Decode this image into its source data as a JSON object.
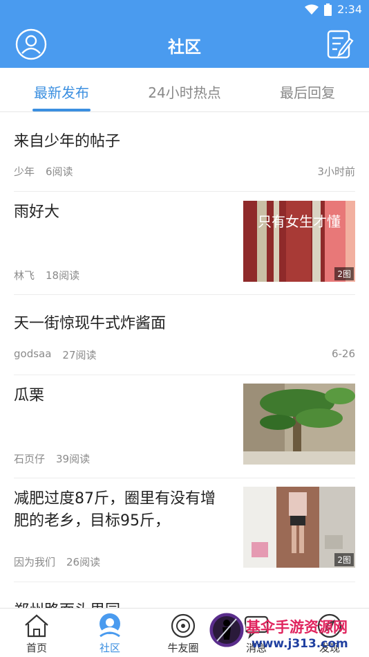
{
  "status_bar": {
    "time": "2:34"
  },
  "header": {
    "title": "社区"
  },
  "tabs": [
    {
      "label": "最新发布",
      "active": true
    },
    {
      "label": "24小时热点",
      "active": false
    },
    {
      "label": "最后回复",
      "active": false
    }
  ],
  "posts": [
    {
      "title": "来自少年的帖子",
      "author": "少年",
      "reads": "6阅读",
      "time": "3小时前"
    },
    {
      "title": "雨好大",
      "author": "林飞",
      "reads": "18阅读",
      "thumb_text": "只有女生才懂",
      "badge": "2图"
    },
    {
      "title": "天一街惊现牛式炸酱面",
      "author": "godsaa",
      "reads": "27阅读",
      "time": "6-26"
    },
    {
      "title": "瓜栗",
      "author": "石页仔",
      "reads": "39阅读"
    },
    {
      "title_line1": "减肥过度87斤，圈里有没有增",
      "title_line2": "肥的老乡，目标95斤，",
      "author": "因为我们",
      "reads": "26阅读",
      "badge": "2图"
    },
    {
      "title": "郑州路面头里园"
    }
  ],
  "bottom_nav": [
    {
      "label": "首页",
      "icon": "home-icon"
    },
    {
      "label": "社区",
      "icon": "community-icon",
      "active": true
    },
    {
      "label": "牛友圈",
      "icon": "circle-icon"
    },
    {
      "label": "消息",
      "icon": "message-icon"
    },
    {
      "label": "发现",
      "icon": "discover-icon"
    }
  ],
  "watermark": {
    "line1": "基伞手游资源网",
    "line2": "www.j313.com"
  },
  "colors": {
    "primary": "#4a9bef",
    "accent": "#3b8fe0"
  }
}
